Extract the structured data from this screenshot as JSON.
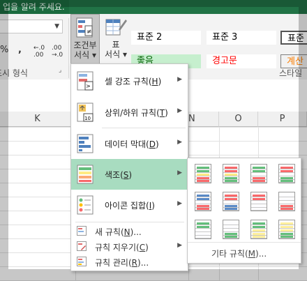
{
  "title_bar": {
    "tell_me": "업을 알려 주세요."
  },
  "ribbon": {
    "percent": "%",
    "comma": ",",
    "inc_decimal": "←.0 .00",
    "dec_decimal": ".00 →.0",
    "number_group": "표시 형식",
    "cond_format_l1": "조건부",
    "cond_format_l2": "서식",
    "table_l1": "표",
    "table_l2": "서식",
    "styles_group": "스타일",
    "styles": [
      {
        "label": "표준 2",
        "bg": "#ffffff",
        "color": "#000000"
      },
      {
        "label": "표준 3",
        "bg": "#ffffff",
        "color": "#000000"
      },
      {
        "label": "표준",
        "bg": "#ffffff",
        "color": "#000000"
      },
      {
        "label": "좋음",
        "bg": "#c6efce",
        "color": "#006100"
      },
      {
        "label": "경고문",
        "bg": "#ffffff",
        "color": "#ff0000"
      },
      {
        "label": "계산",
        "bg": "#f2f2f2",
        "color": "#fa7d00"
      }
    ]
  },
  "columns": [
    "K",
    "N",
    "O",
    "P"
  ],
  "menu": {
    "items": [
      {
        "label": "셀 강조 규칙",
        "key": "H"
      },
      {
        "label": "상위/하위 규칙",
        "key": "T"
      },
      {
        "label": "데이터 막대",
        "key": "D"
      },
      {
        "label": "색조",
        "key": "S"
      },
      {
        "label": "아이콘 집합",
        "key": "I"
      }
    ],
    "small_items": [
      {
        "label": "새 규칙",
        "key": "N",
        "suffix": "..."
      },
      {
        "label": "규칙 지우기",
        "key": "C",
        "suffix": ""
      },
      {
        "label": "규칙 관리",
        "key": "R",
        "suffix": "..."
      }
    ],
    "more_rules": "기타 규칙",
    "more_rules_key": "M"
  },
  "color_scales": [
    [
      "#63be7b",
      "#ffeb84",
      "#f8696b"
    ],
    [
      "#f8696b",
      "#ffeb84",
      "#63be7b"
    ],
    [
      "#63be7b",
      "#fcfcff",
      "#f8696b"
    ],
    [
      "#f8696b",
      "#fcfcff",
      "#63be7b"
    ],
    [
      "#5a8ac6",
      "#fcfcff",
      "#f8696b"
    ],
    [
      "#f8696b",
      "#fcfcff",
      "#5a8ac6"
    ],
    [
      "#f8696b",
      "#fcfcff",
      "#fcfcff"
    ],
    [
      "#fcfcff",
      "#fcfcff",
      "#f8696b"
    ],
    [
      "#63be7b",
      "#fcfcff",
      "#fcfcff"
    ],
    [
      "#fcfcff",
      "#fcfcff",
      "#63be7b"
    ],
    [
      "#63be7b",
      "#ffef9c",
      "#ffef9c"
    ],
    [
      "#ffef9c",
      "#ffef9c",
      "#63be7b"
    ]
  ]
}
